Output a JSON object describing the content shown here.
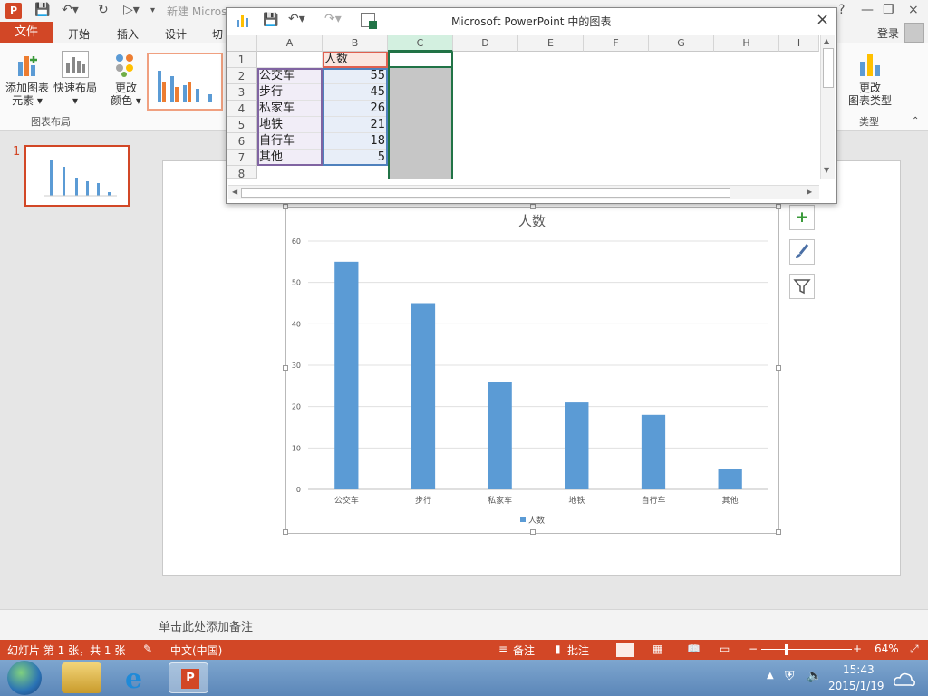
{
  "titlebar": {
    "title": "新建 Micros",
    "buttons": [
      "?",
      "—",
      "❐",
      "×"
    ]
  },
  "tabs": {
    "file": "文件",
    "items": [
      "开始",
      "插入",
      "设计",
      "切"
    ],
    "login": "登录"
  },
  "ribbon": {
    "add_element": [
      "添加图表",
      "元素 ▾"
    ],
    "quick_layout": [
      "快速布局",
      "▾"
    ],
    "change_color": [
      "更改",
      "颜色 ▾"
    ],
    "group_layout": "图表布局",
    "change_type": [
      "更改",
      "图表类型"
    ],
    "group_type": "类型"
  },
  "thumbnail": {
    "number": "1"
  },
  "spreadsheet": {
    "title": "Microsoft PowerPoint 中的图表",
    "columns": [
      "A",
      "B",
      "C",
      "D",
      "E",
      "F",
      "G",
      "H",
      "I"
    ],
    "rows": [
      "1",
      "2",
      "3",
      "4",
      "5",
      "6",
      "7",
      "8"
    ],
    "header_b1": "人数",
    "data_rows": [
      [
        "公交车",
        "55"
      ],
      [
        "步行",
        "45"
      ],
      [
        "私家车",
        "26"
      ],
      [
        "地铁",
        "21"
      ],
      [
        "自行车",
        "18"
      ],
      [
        "其他",
        "5"
      ]
    ]
  },
  "chart_data": {
    "type": "bar",
    "title": "人数",
    "categories": [
      "公交车",
      "步行",
      "私家车",
      "地铁",
      "自行车",
      "其他"
    ],
    "series": [
      {
        "name": "人数",
        "values": [
          55,
          45,
          26,
          21,
          18,
          5
        ]
      }
    ],
    "ylim": [
      0,
      60
    ],
    "yticks": [
      0,
      10,
      20,
      30,
      40,
      50,
      60
    ],
    "grid": true,
    "legend": "bottom",
    "color": "#5b9bd5"
  },
  "side_buttons": [
    "+",
    "brush-icon",
    "filter-icon"
  ],
  "notes": {
    "placeholder": "单击此处添加备注"
  },
  "status": {
    "slide_info": "幻灯片 第 1 张，共 1 张",
    "language": "中文(中国)",
    "notes_btn": "备注",
    "comments_btn": "批注",
    "zoom": "64%"
  },
  "taskbar": {
    "time": "15:43",
    "date": "2015/1/19"
  },
  "colors": {
    "accent": "#d24726",
    "bar": "#5b9bd5"
  }
}
